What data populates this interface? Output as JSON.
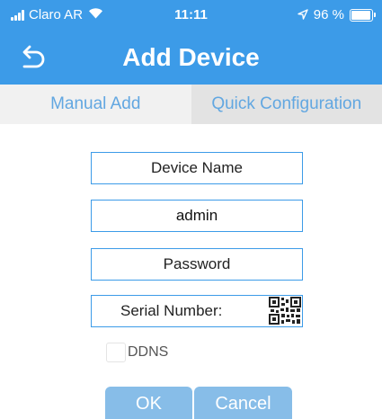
{
  "status_bar": {
    "carrier": "Claro AR",
    "time": "11:11",
    "battery_text": "96 %",
    "battery_level": 0.96,
    "icons": [
      "signal-icon",
      "wifi-icon",
      "location-arrow-icon",
      "battery-icon"
    ]
  },
  "nav": {
    "title": "Add Device",
    "back_icon": "back-arrow-icon"
  },
  "tabs": [
    {
      "label": "Manual Add",
      "active": false
    },
    {
      "label": "Quick Configuration",
      "active": true
    }
  ],
  "form": {
    "device_name": {
      "value": "",
      "placeholder": "Device Name"
    },
    "username": {
      "value": "admin",
      "placeholder": ""
    },
    "password": {
      "value": "",
      "placeholder": "Password"
    },
    "serial_number": {
      "value": "",
      "placeholder": "Serial Number:"
    },
    "qr_icon": "qr-code-icon",
    "ddns": {
      "label": "DDNS",
      "checked": false
    }
  },
  "buttons": {
    "ok_label": "OK",
    "cancel_label": "Cancel"
  },
  "colors": {
    "accent": "#3c9be8",
    "tab_text": "#62a7e1",
    "button_bg": "#87bde8"
  }
}
